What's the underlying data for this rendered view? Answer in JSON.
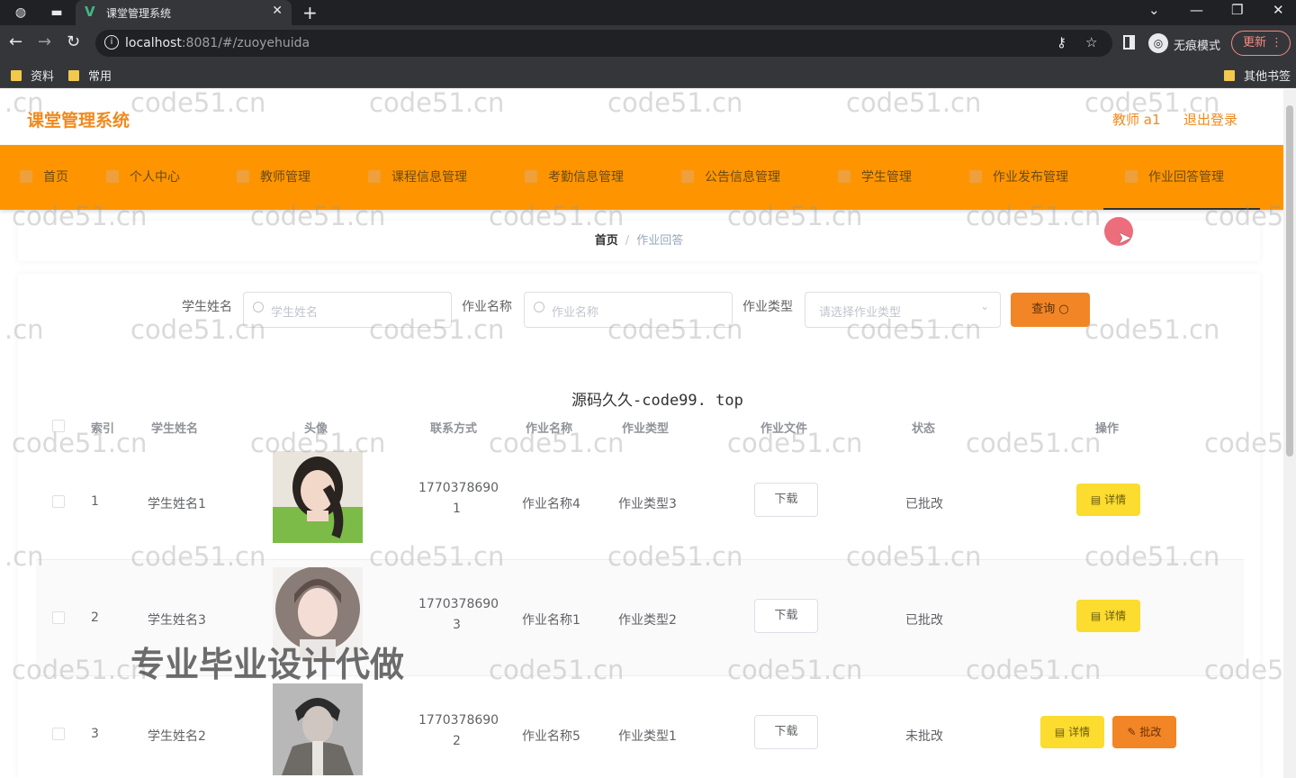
{
  "browser": {
    "tab_title": "课堂管理系统",
    "url_host": "localhost",
    "url_rest": ":8081/#/zuoyehuida",
    "incognito_label": "无痕模式",
    "update_label": "更新",
    "bookmarks": [
      "资料",
      "常用"
    ],
    "other_bookmarks": "其他书签"
  },
  "app": {
    "brand": "课堂管理系统",
    "user": "教师 a1",
    "logout": "退出登录",
    "accent_color": "#fe9500"
  },
  "menu": [
    {
      "label": "首页"
    },
    {
      "label": "个人中心"
    },
    {
      "label": "教师管理"
    },
    {
      "label": "课程信息管理"
    },
    {
      "label": "考勤信息管理"
    },
    {
      "label": "公告信息管理"
    },
    {
      "label": "学生管理"
    },
    {
      "label": "作业发布管理"
    },
    {
      "label": "作业回答管理"
    }
  ],
  "breadcrumb": {
    "home": "首页",
    "sep": "/",
    "current": "作业回答"
  },
  "search": {
    "student_label": "学生姓名",
    "student_placeholder": "学生姓名",
    "work_label": "作业名称",
    "work_placeholder": "作业名称",
    "type_label": "作业类型",
    "type_placeholder": "请选择作业类型",
    "query_label": "查询"
  },
  "watermark_title": "源码久久-code99. top",
  "table": {
    "headers": [
      "索引",
      "学生姓名",
      "头像",
      "联系方式",
      "作业名称",
      "作业类型",
      "作业文件",
      "状态",
      "操作"
    ],
    "rows": [
      {
        "index": "1",
        "name": "学生姓名1",
        "phone1": "1770378690",
        "phone2": "1",
        "work": "作业名称4",
        "type": "作业类型3",
        "file": "下载",
        "status": "已批改",
        "detail": "详情"
      },
      {
        "index": "2",
        "name": "学生姓名3",
        "phone1": "1770378690",
        "phone2": "3",
        "work": "作业名称1",
        "type": "作业类型2",
        "file": "下载",
        "status": "已批改",
        "detail": "详情"
      },
      {
        "index": "3",
        "name": "学生姓名2",
        "phone1": "1770378690",
        "phone2": "2",
        "work": "作业名称5",
        "type": "作业类型1",
        "file": "下载",
        "status": "未批改",
        "detail": "详情",
        "review": "批改"
      }
    ]
  },
  "overlay": {
    "promo": "专业毕业设计代做",
    "watermark": "code51.cn",
    "watermark_cn": ".cn",
    "watermark_cut": "code5"
  }
}
